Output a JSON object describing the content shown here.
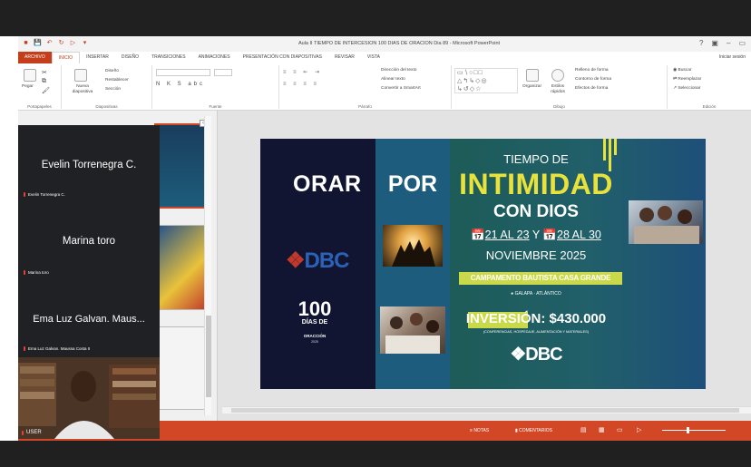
{
  "app": {
    "window_title": "Aula II TIEMPO DE INTERCESION 100 DIAS DE ORACION Dia 89 - Microsoft PowerPoint",
    "signin": "Iniciar sesión"
  },
  "tabs": [
    "ARCHIVO",
    "INICIO",
    "INSERTAR",
    "DISEÑO",
    "TRANSICIONES",
    "ANIMACIONES",
    "PRESENTACIÓN CON DIAPOSITIVAS",
    "REVISAR",
    "VISTA"
  ],
  "ribbon": {
    "clipboard": {
      "paste": "Pegar",
      "label": "Portapapeles"
    },
    "slides": {
      "new_slide": "Nueva diapositiva",
      "layout": "Diseño",
      "reset": "Restablecer",
      "section": "Sección",
      "label": "Diapositivas"
    },
    "font": {
      "label": "Fuente"
    },
    "paragraph": {
      "text_direction": "Dirección del texto",
      "align_text": "Alinear texto",
      "smartart": "Convertir a SmartArt",
      "label": "Párrafo"
    },
    "drawing": {
      "arrange": "Organizar",
      "quick_styles": "Estilos rápidos",
      "fill": "Relleno de forma",
      "outline": "Contorno de forma",
      "effects": "Efectos de forma",
      "label": "Dibujo"
    },
    "editing": {
      "find": "Buscar",
      "replace": "Reemplazar",
      "select": "Seleccionar",
      "label": "Edición"
    }
  },
  "slide": {
    "orar": "ORAR",
    "por": "POR",
    "tiempo": "TIEMPO DE",
    "intimidad": "INTIMIDAD",
    "con_dios": "CON DIOS",
    "date1": "21 AL 23",
    "y": "Y",
    "date2": "28 AL 30",
    "month": "NOVIEMBRE 2025",
    "campamento": "CAMPAMENTO BAUTISTA CASA GRANDE",
    "location": "GALAPA · ATLÁNTICO",
    "inversion_label": "INVERSIÓN:",
    "inversion_value": "$430.000",
    "inversion_sub": "(CONFERENCIAS, HOSPEDAJE, ALIMENTACIÓN Y MATERIALES)",
    "dbc": "DBC",
    "dias_num": "100",
    "dias_lbl": "DÍAS DE",
    "oracion": "ORACCIÓN",
    "year": "2025"
  },
  "statusbar": {
    "notes": "NOTAS",
    "comments": "COMENTARIOS"
  },
  "call": {
    "participants": [
      {
        "name": "Evelin Torrenegra C.",
        "tag": "Evelin Torrenegra C."
      },
      {
        "name": "Marina toro",
        "tag": "Marina toro"
      },
      {
        "name": "Ema Luz Galvan. Maus...",
        "tag": "Ema Luz Galvan. Maussa Costa II"
      }
    ],
    "self_tag": "USER"
  },
  "colors": {
    "accent": "#c43e1c",
    "statusbar": "#d24726",
    "slide_yellow": "#e8e23b",
    "call_bg": "#202124"
  }
}
